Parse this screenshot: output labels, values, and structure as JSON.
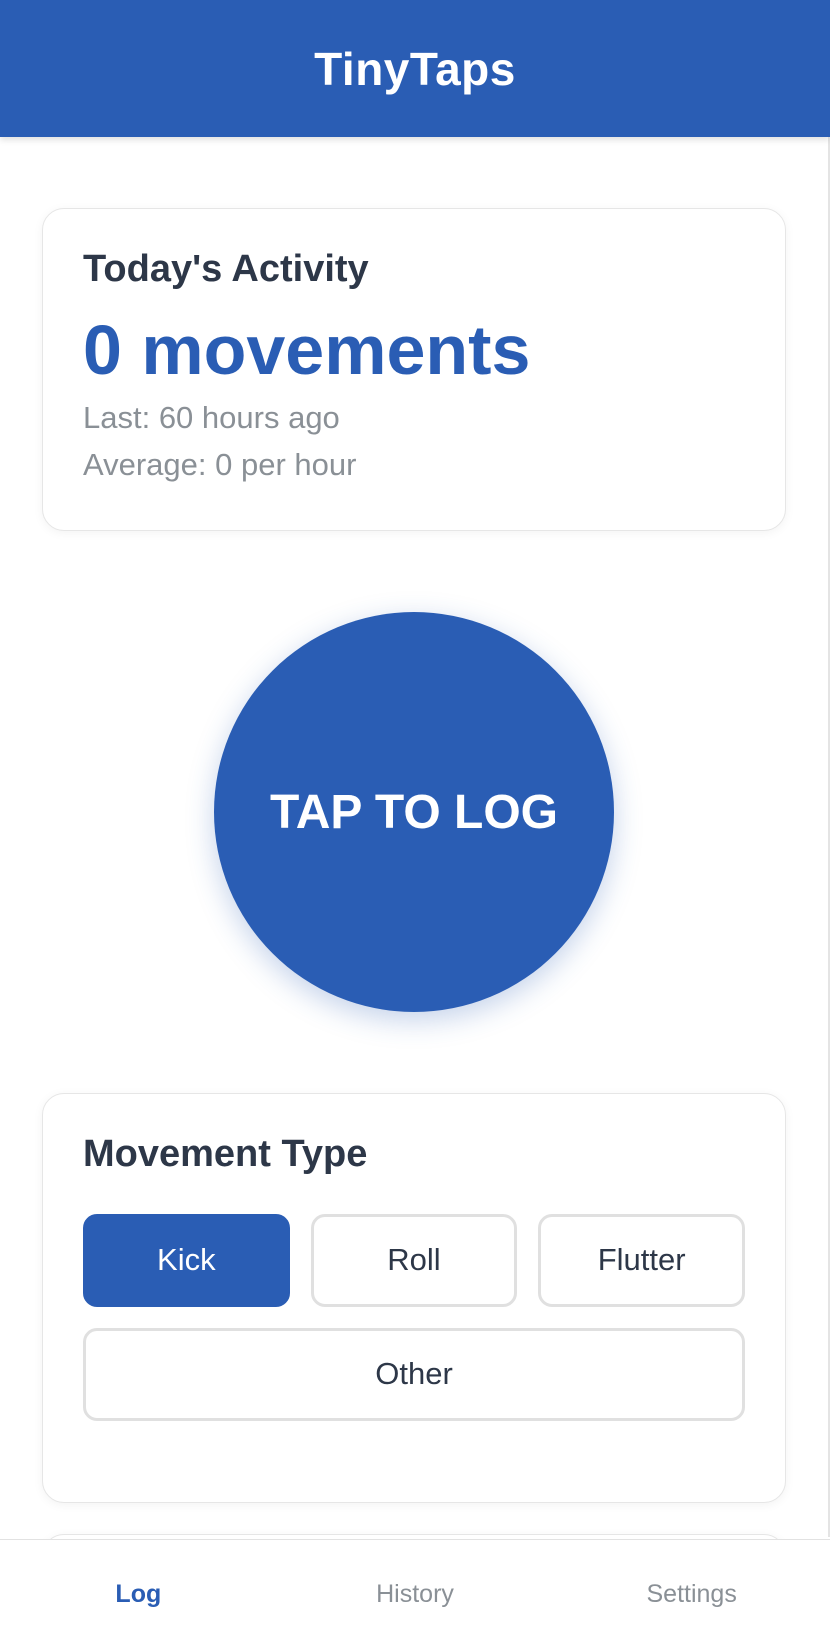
{
  "header": {
    "title": "TinyTaps"
  },
  "activity": {
    "heading": "Today's Activity",
    "count_text": "0 movements",
    "last_text": "Last: 60 hours ago",
    "average_text": "Average: 0 per hour"
  },
  "tap_button": {
    "label": "TAP TO LOG"
  },
  "movement_type": {
    "heading": "Movement Type",
    "options": [
      {
        "label": "Kick",
        "selected": true
      },
      {
        "label": "Roll",
        "selected": false
      },
      {
        "label": "Flutter",
        "selected": false
      },
      {
        "label": "Other",
        "selected": false
      }
    ]
  },
  "nav": {
    "items": [
      {
        "label": "Log",
        "active": true
      },
      {
        "label": "History",
        "active": false
      },
      {
        "label": "Settings",
        "active": false
      }
    ]
  },
  "colors": {
    "primary": "#2a5db4",
    "text_dark": "#2d3748",
    "text_muted": "#8a9096"
  }
}
